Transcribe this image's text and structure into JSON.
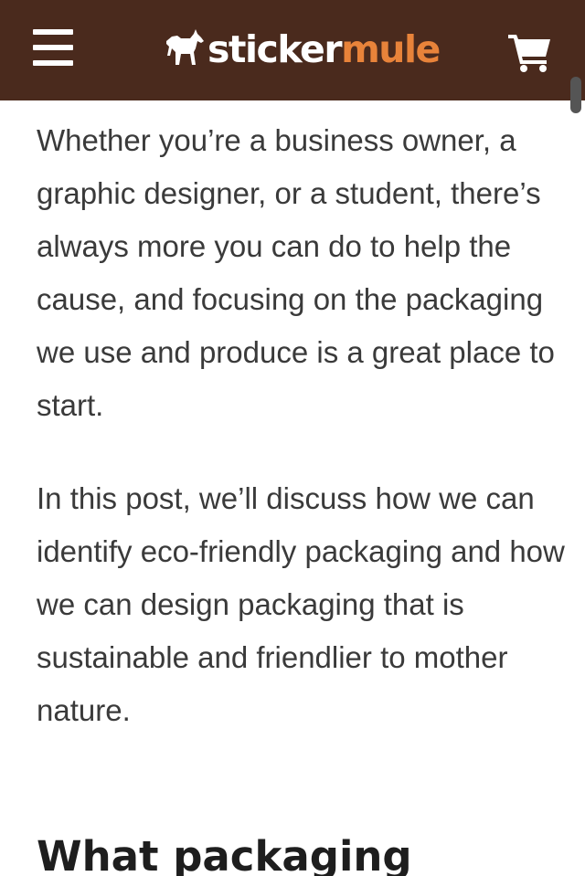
{
  "header": {
    "logo_part1": "sticker",
    "logo_part2": "mule",
    "background_color": "#4a2a1d",
    "accent_color": "#e8833a",
    "menu_icon": "hamburger-menu-icon",
    "cart_icon": "shopping-cart-icon"
  },
  "article": {
    "partial_line": "",
    "paragraphs": [
      "Whether you’re a business owner, a graphic designer, or a student, there’s always more you can do to help the cause, and focusing on the packaging we use and produce is a great place to start.",
      "In this post, we’ll discuss how we can identify eco-friendly packaging and how we can design packaging that is sustainable and friendlier to mother nature."
    ],
    "heading": "What packaging"
  }
}
